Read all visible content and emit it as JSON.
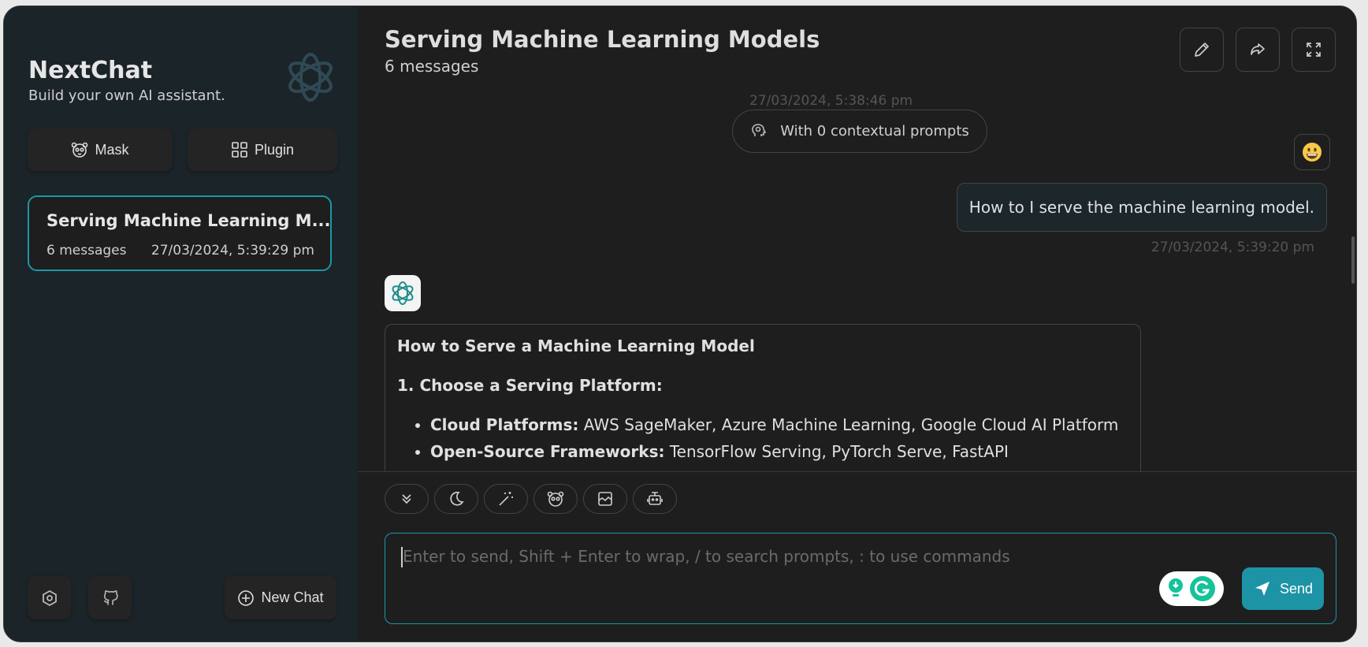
{
  "sidebar": {
    "title": "NextChat",
    "subtitle": "Build your own AI assistant.",
    "mask_label": "Mask",
    "plugin_label": "Plugin",
    "session": {
      "title": "Serving Machine Learning M...",
      "count": "6 messages",
      "time": "27/03/2024, 5:39:29 pm"
    },
    "new_chat_label": "New Chat"
  },
  "chat": {
    "title": "Serving Machine Learning Models",
    "subtitle": "6 messages",
    "context_time": "27/03/2024, 5:38:46 pm",
    "context_label": "With 0 contextual prompts",
    "user_avatar": "😃",
    "user_message": "How to I serve the machine learning model.",
    "user_time": "27/03/2024, 5:39:20 pm",
    "bot_message": {
      "heading": "How to Serve a Machine Learning Model",
      "step1": "1. Choose a Serving Platform:",
      "items": [
        {
          "label": "Cloud Platforms:",
          "text": " AWS SageMaker, Azure Machine Learning, Google Cloud AI Platform"
        },
        {
          "label": "Open-Source Frameworks:",
          "text": " TensorFlow Serving, PyTorch Serve, FastAPI"
        }
      ]
    }
  },
  "input": {
    "placeholder": "Enter to send, Shift + Enter to wrap, / to search prompts, : to use commands",
    "send_label": "Send"
  },
  "colors": {
    "accent": "#1d93a6",
    "sidebar_bg": "#1b2429",
    "main_bg": "#1e1e1e"
  },
  "icons": [
    "openai-logo-icon",
    "mask-icon",
    "plugin-icon",
    "settings-icon",
    "github-icon",
    "add-icon",
    "edit-icon",
    "share-icon",
    "fullscreen-icon",
    "brain-icon",
    "scroll-down-icon",
    "theme-icon",
    "prompt-icon",
    "masks-icon",
    "image-icon",
    "robot-icon",
    "send-icon",
    "grammarly-icon"
  ]
}
